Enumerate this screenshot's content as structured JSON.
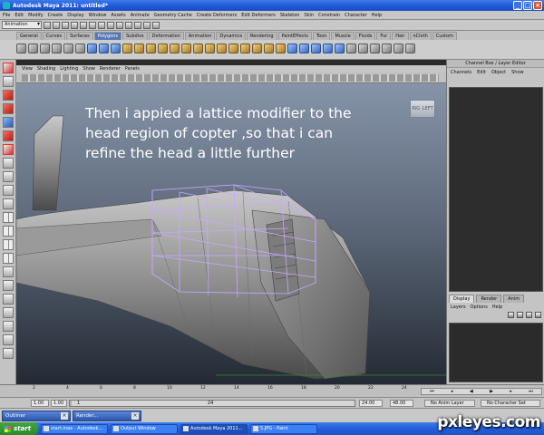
{
  "window": {
    "title": "Autodesk Maya 2011: untitled*"
  },
  "menubar": [
    "File",
    "Edit",
    "Modify",
    "Create",
    "Display",
    "Window",
    "Assets",
    "Animate",
    "Geometry Cache",
    "Create Deformers",
    "Edit Deformers",
    "Skeleton",
    "Skin",
    "Constrain",
    "Character",
    "Help"
  ],
  "statusline": {
    "mode": "Animation"
  },
  "shelf_tabs": [
    "General",
    "Curves",
    "Surfaces",
    "Polygons",
    "Subdivs",
    "Deformation",
    "Animation",
    "Dynamics",
    "Rendering",
    "PaintEffects",
    "Toon",
    "Muscle",
    "Fluids",
    "Fur",
    "Hair",
    "nCloth",
    "Custom"
  ],
  "shelf_active": "Polygons",
  "panel_menu": [
    "View",
    "Shading",
    "Lighting",
    "Show",
    "Renderer",
    "Panels"
  ],
  "viewport": {
    "caption": "Then i appied a lattice modifier to the head region of copter ,so that i can refine the head a little further",
    "viewcube_left": "RIG",
    "viewcube_right": "LEFT"
  },
  "channel_box": {
    "title": "Channel Box / Layer Editor",
    "menu": [
      "Channels",
      "Edit",
      "Object",
      "Show"
    ]
  },
  "layer_editor": {
    "tabs": [
      "Display",
      "Render",
      "Anim"
    ],
    "menu": [
      "Layers",
      "Options",
      "Help"
    ]
  },
  "timeline": {
    "ticks": [
      "2",
      "4",
      "6",
      "8",
      "10",
      "12",
      "14",
      "16",
      "18",
      "20",
      "22",
      "24"
    ]
  },
  "range": {
    "start": "1.00",
    "playback_start": "1.00",
    "range_start_label": "1",
    "range_end_label": "24",
    "playback_end": "24.00",
    "end": "48.00",
    "anim_layer": "No Anim Layer",
    "character_set": "No Character Set"
  },
  "minimized_windows": [
    "Outliner",
    "Render..."
  ],
  "taskbar": {
    "start": "start",
    "tasks": [
      "start.max - Autodesk...",
      "Output Window",
      "Autodesk Maya 2011...",
      "5.JPG - Paint"
    ]
  },
  "watermark": "pxleyes.com",
  "colors": {
    "title_bar": "#245edb",
    "viewport_top": "#8694a8",
    "viewport_bottom": "#232a34",
    "lattice": "#c9a7ff"
  }
}
